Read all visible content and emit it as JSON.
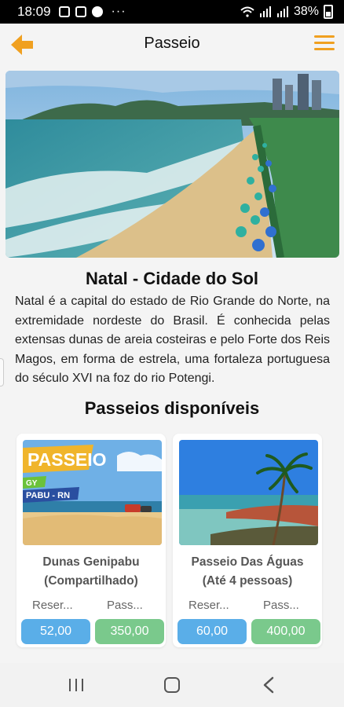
{
  "status_bar": {
    "time": "18:09",
    "dots": "···",
    "battery": "38%"
  },
  "header": {
    "title": "Passeio",
    "back_icon": "arrow-left-icon",
    "menu_icon": "hamburger-menu-icon",
    "accent_color": "#f0a020"
  },
  "city": {
    "title": "Natal - Cidade do Sol",
    "description": "Natal é a capital do estado de Rio Grande do Norte, na extremidade nordeste do Brasil. É conhecida pelas extensas dunas de areia costeiras e pelo Forte dos Reis Magos, em forma de estrela, uma fortaleza portuguesa do século XVI na foz do rio Potengi."
  },
  "tours": {
    "section_title": "Passeios disponíveis",
    "items": [
      {
        "title_line1": "Dunas Genipabu",
        "title_line2": "(Compartilhado)",
        "reserve_label": "Reser...",
        "price_label": "Pass...",
        "reserve_value": "52,00",
        "price_value": "350,00",
        "image_text_main": "PASSEIO",
        "image_text_tag": "GY",
        "image_text_place": "PABU - RN"
      },
      {
        "title_line1": "Passeio Das Águas",
        "title_line2": "(Até 4 pessoas)",
        "reserve_label": "Reser...",
        "price_label": "Pass...",
        "reserve_value": "60,00",
        "price_value": "400,00"
      }
    ],
    "reserve_color": "#5aaee8",
    "price_color": "#7ac98c"
  }
}
